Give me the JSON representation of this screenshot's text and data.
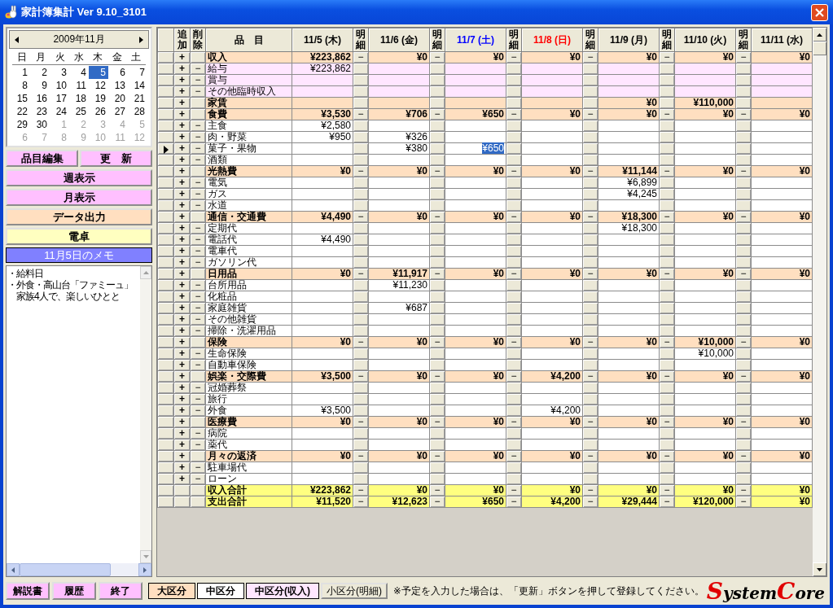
{
  "window": {
    "title": "家計簿集計 Ver 9.10_3101"
  },
  "calendar": {
    "title": "2009年11月",
    "weekdays": [
      "日",
      "月",
      "火",
      "水",
      "木",
      "金",
      "土"
    ],
    "days": [
      {
        "d": "1",
        "other_month": false,
        "selected": false
      },
      {
        "d": "2",
        "other_month": false,
        "selected": false
      },
      {
        "d": "3",
        "other_month": false,
        "selected": false
      },
      {
        "d": "4",
        "other_month": false,
        "selected": false
      },
      {
        "d": "5",
        "other_month": false,
        "selected": true
      },
      {
        "d": "6",
        "other_month": false,
        "selected": false
      },
      {
        "d": "7",
        "other_month": false,
        "selected": false
      },
      {
        "d": "8",
        "other_month": false,
        "selected": false
      },
      {
        "d": "9",
        "other_month": false,
        "selected": false
      },
      {
        "d": "10",
        "other_month": false,
        "selected": false
      },
      {
        "d": "11",
        "other_month": false,
        "selected": false
      },
      {
        "d": "12",
        "other_month": false,
        "selected": false
      },
      {
        "d": "13",
        "other_month": false,
        "selected": false
      },
      {
        "d": "14",
        "other_month": false,
        "selected": false
      },
      {
        "d": "15",
        "other_month": false,
        "selected": false
      },
      {
        "d": "16",
        "other_month": false,
        "selected": false
      },
      {
        "d": "17",
        "other_month": false,
        "selected": false
      },
      {
        "d": "18",
        "other_month": false,
        "selected": false
      },
      {
        "d": "19",
        "other_month": false,
        "selected": false
      },
      {
        "d": "20",
        "other_month": false,
        "selected": false
      },
      {
        "d": "21",
        "other_month": false,
        "selected": false
      },
      {
        "d": "22",
        "other_month": false,
        "selected": false
      },
      {
        "d": "23",
        "other_month": false,
        "selected": false
      },
      {
        "d": "24",
        "other_month": false,
        "selected": false
      },
      {
        "d": "25",
        "other_month": false,
        "selected": false
      },
      {
        "d": "26",
        "other_month": false,
        "selected": false
      },
      {
        "d": "27",
        "other_month": false,
        "selected": false
      },
      {
        "d": "28",
        "other_month": false,
        "selected": false
      },
      {
        "d": "29",
        "other_month": false,
        "selected": false
      },
      {
        "d": "30",
        "other_month": false,
        "selected": false
      },
      {
        "d": "1",
        "other_month": true,
        "selected": false
      },
      {
        "d": "2",
        "other_month": true,
        "selected": false
      },
      {
        "d": "3",
        "other_month": true,
        "selected": false
      },
      {
        "d": "4",
        "other_month": true,
        "selected": false
      },
      {
        "d": "5",
        "other_month": true,
        "selected": false
      },
      {
        "d": "6",
        "other_month": true,
        "selected": false
      },
      {
        "d": "7",
        "other_month": true,
        "selected": false
      },
      {
        "d": "8",
        "other_month": true,
        "selected": false
      },
      {
        "d": "9",
        "other_month": true,
        "selected": false
      },
      {
        "d": "10",
        "other_month": true,
        "selected": false
      },
      {
        "d": "11",
        "other_month": true,
        "selected": false
      },
      {
        "d": "12",
        "other_month": true,
        "selected": false
      }
    ]
  },
  "side_buttons": [
    [
      {
        "label": "品目編集",
        "color": "#ffc0ff"
      },
      {
        "label": "更　新",
        "color": "#ffc0ff"
      }
    ],
    [
      {
        "label": "週表示",
        "color": "#ffc0ff"
      }
    ],
    [
      {
        "label": "月表示",
        "color": "#ffc0ff"
      }
    ],
    [
      {
        "label": "データ出力",
        "color": "#ffdfc0"
      }
    ],
    [
      {
        "label": "電卓",
        "color": "#ffffc0"
      }
    ]
  ],
  "memo": {
    "title": "11月5日のメモ",
    "lines": [
      {
        "text": "・給料日",
        "indent": false
      },
      {
        "text": "・外食・高山台「ファミーュ」",
        "indent": false
      },
      {
        "text": "家族4人で、楽しいひとと",
        "indent": true
      }
    ]
  },
  "table": {
    "headers": {
      "add": "追加",
      "remove": "削除",
      "item": "品　目"
    },
    "columns": [
      {
        "label": "11/5 (木)",
        "color": "#000000",
        "selected": false,
        "detail_header": "明細"
      },
      {
        "label": "11/6 (金)",
        "color": "#000000",
        "selected": false,
        "detail_header": "明細"
      },
      {
        "label": "11/7 (土)",
        "color": "#0000ff",
        "selected": true,
        "detail_header": "明細"
      },
      {
        "label": "11/8 (日)",
        "color": "#ff0000",
        "selected": false,
        "detail_header": "明細"
      },
      {
        "label": "11/9 (月)",
        "color": "#000000",
        "selected": false,
        "detail_header": "明細"
      },
      {
        "label": "11/10 (火)",
        "color": "#000000",
        "selected": false,
        "detail_header": "明細"
      },
      {
        "label": "11/11 (水)",
        "color": "#000000",
        "selected": false
      }
    ],
    "rows": [
      {
        "kind": "category",
        "name": "収入",
        "add": "+",
        "detail": "−",
        "selected": false,
        "cells": [
          "¥223,862",
          "¥0",
          "¥0",
          "¥0",
          "¥0",
          "¥0",
          "¥0"
        ]
      },
      {
        "kind": "income",
        "name": "給与",
        "add": "+",
        "remove": "−",
        "selected": false,
        "cells": [
          "¥223,862",
          null,
          null,
          null,
          null,
          null,
          null
        ]
      },
      {
        "kind": "income",
        "name": "賞与",
        "add": "+",
        "remove": "−",
        "selected": false,
        "cells": [
          null,
          null,
          null,
          null,
          null,
          null,
          null
        ]
      },
      {
        "kind": "income",
        "name": "その他臨時収入",
        "add": "+",
        "remove": "−",
        "selected": false,
        "cells": [
          null,
          null,
          null,
          null,
          null,
          null,
          null
        ]
      },
      {
        "kind": "category",
        "name": "家賃",
        "add": "+",
        "selected": false,
        "cells": [
          null,
          null,
          null,
          null,
          "¥0",
          "¥110,000",
          null
        ]
      },
      {
        "kind": "category",
        "name": "食費",
        "add": "+",
        "detail": "−",
        "selected": false,
        "cells": [
          "¥3,530",
          "¥706",
          "¥650",
          "¥0",
          "¥0",
          "¥0",
          "¥0"
        ]
      },
      {
        "kind": "item",
        "name": "主食",
        "add": "+",
        "remove": "−",
        "selected": false,
        "cells": [
          "¥2,580",
          null,
          null,
          null,
          null,
          null,
          null
        ]
      },
      {
        "kind": "item",
        "name": "肉・野菜",
        "add": "+",
        "remove": "−",
        "selected": false,
        "cells": [
          "¥950",
          "¥326",
          null,
          null,
          null,
          null,
          null
        ]
      },
      {
        "kind": "item",
        "name": "菓子・果物",
        "add": "+",
        "remove": "−",
        "selected": true,
        "cells": [
          null,
          "¥380",
          "¥650",
          null,
          null,
          null,
          null
        ]
      },
      {
        "kind": "item",
        "name": "酒類",
        "add": "+",
        "remove": "−",
        "selected": false,
        "cells": [
          null,
          null,
          null,
          null,
          null,
          null,
          null
        ]
      },
      {
        "kind": "category",
        "name": "光熱費",
        "add": "+",
        "detail": "−",
        "selected": false,
        "cells": [
          "¥0",
          "¥0",
          "¥0",
          "¥0",
          "¥11,144",
          "¥0",
          "¥0"
        ]
      },
      {
        "kind": "item",
        "name": "電気",
        "add": "+",
        "remove": "−",
        "selected": false,
        "cells": [
          null,
          null,
          null,
          null,
          "¥6,899",
          null,
          null
        ]
      },
      {
        "kind": "item",
        "name": "ガス",
        "add": "+",
        "remove": "−",
        "selected": false,
        "cells": [
          null,
          null,
          null,
          null,
          "¥4,245",
          null,
          null
        ]
      },
      {
        "kind": "item",
        "name": "水道",
        "add": "+",
        "remove": "−",
        "selected": false,
        "cells": [
          null,
          null,
          null,
          null,
          null,
          null,
          null
        ]
      },
      {
        "kind": "category",
        "name": "通信・交通費",
        "add": "+",
        "detail": "−",
        "selected": false,
        "cells": [
          "¥4,490",
          "¥0",
          "¥0",
          "¥0",
          "¥18,300",
          "¥0",
          "¥0"
        ]
      },
      {
        "kind": "item",
        "name": "定期代",
        "add": "+",
        "remove": "−",
        "selected": false,
        "cells": [
          null,
          null,
          null,
          null,
          "¥18,300",
          null,
          null
        ]
      },
      {
        "kind": "item",
        "name": "電話代",
        "add": "+",
        "remove": "−",
        "selected": false,
        "cells": [
          "¥4,490",
          null,
          null,
          null,
          null,
          null,
          null
        ]
      },
      {
        "kind": "item",
        "name": "電車代",
        "add": "+",
        "remove": "−",
        "selected": false,
        "cells": [
          null,
          null,
          null,
          null,
          null,
          null,
          null
        ]
      },
      {
        "kind": "item",
        "name": "ガソリン代",
        "add": "+",
        "remove": "−",
        "selected": false,
        "cells": [
          null,
          null,
          null,
          null,
          null,
          null,
          null
        ]
      },
      {
        "kind": "category",
        "name": "日用品",
        "add": "+",
        "detail": "−",
        "selected": false,
        "cells": [
          "¥0",
          "¥11,917",
          "¥0",
          "¥0",
          "¥0",
          "¥0",
          "¥0"
        ]
      },
      {
        "kind": "item",
        "name": "台所用品",
        "add": "+",
        "remove": "−",
        "selected": false,
        "cells": [
          null,
          "¥11,230",
          null,
          null,
          null,
          null,
          null
        ]
      },
      {
        "kind": "item",
        "name": "化粧品",
        "add": "+",
        "remove": "−",
        "selected": false,
        "cells": [
          null,
          null,
          null,
          null,
          null,
          null,
          null
        ]
      },
      {
        "kind": "item",
        "name": "家庭雑貨",
        "add": "+",
        "remove": "−",
        "selected": false,
        "cells": [
          null,
          "¥687",
          null,
          null,
          null,
          null,
          null
        ]
      },
      {
        "kind": "item",
        "name": "その他雑貨",
        "add": "+",
        "remove": "−",
        "selected": false,
        "cells": [
          null,
          null,
          null,
          null,
          null,
          null,
          null
        ]
      },
      {
        "kind": "item",
        "name": "掃除・洗濯用品",
        "add": "+",
        "remove": "−",
        "selected": false,
        "cells": [
          null,
          null,
          null,
          null,
          null,
          null,
          null
        ]
      },
      {
        "kind": "category",
        "name": "保険",
        "add": "+",
        "detail": "−",
        "selected": false,
        "cells": [
          "¥0",
          "¥0",
          "¥0",
          "¥0",
          "¥0",
          "¥10,000",
          "¥0"
        ]
      },
      {
        "kind": "item",
        "name": "生命保険",
        "add": "+",
        "remove": "−",
        "selected": false,
        "cells": [
          null,
          null,
          null,
          null,
          null,
          "¥10,000",
          null
        ]
      },
      {
        "kind": "item",
        "name": "自動車保険",
        "add": "+",
        "remove": "−",
        "selected": false,
        "cells": [
          null,
          null,
          null,
          null,
          null,
          null,
          null
        ]
      },
      {
        "kind": "category",
        "name": "娯楽・交際費",
        "add": "+",
        "detail": "−",
        "selected": false,
        "cells": [
          "¥3,500",
          "¥0",
          "¥0",
          "¥4,200",
          "¥0",
          "¥0",
          "¥0"
        ]
      },
      {
        "kind": "item",
        "name": "冠婚葬祭",
        "add": "+",
        "remove": "−",
        "selected": false,
        "cells": [
          null,
          null,
          null,
          null,
          null,
          null,
          null
        ]
      },
      {
        "kind": "item",
        "name": "旅行",
        "add": "+",
        "remove": "−",
        "selected": false,
        "cells": [
          null,
          null,
          null,
          null,
          null,
          null,
          null
        ]
      },
      {
        "kind": "item",
        "name": "外食",
        "add": "+",
        "remove": "−",
        "selected": false,
        "cells": [
          "¥3,500",
          null,
          null,
          "¥4,200",
          null,
          null,
          null
        ]
      },
      {
        "kind": "category",
        "name": "医療費",
        "add": "+",
        "detail": "−",
        "selected": false,
        "cells": [
          "¥0",
          "¥0",
          "¥0",
          "¥0",
          "¥0",
          "¥0",
          "¥0"
        ]
      },
      {
        "kind": "item",
        "name": "病院",
        "add": "+",
        "remove": "−",
        "selected": false,
        "cells": [
          null,
          null,
          null,
          null,
          null,
          null,
          null
        ]
      },
      {
        "kind": "item",
        "name": "薬代",
        "add": "+",
        "remove": "−",
        "selected": false,
        "cells": [
          null,
          null,
          null,
          null,
          null,
          null,
          null
        ]
      },
      {
        "kind": "category",
        "name": "月々の返済",
        "add": "+",
        "detail": "−",
        "selected": false,
        "cells": [
          "¥0",
          "¥0",
          "¥0",
          "¥0",
          "¥0",
          "¥0",
          "¥0"
        ]
      },
      {
        "kind": "item",
        "name": "駐車場代",
        "add": "+",
        "remove": "−",
        "selected": false,
        "cells": [
          null,
          null,
          null,
          null,
          null,
          null,
          null
        ]
      },
      {
        "kind": "item",
        "name": "ローン",
        "add": "+",
        "remove": "−",
        "selected": false,
        "cells": [
          null,
          null,
          null,
          null,
          null,
          null,
          null
        ]
      },
      {
        "kind": "total",
        "name": "収入合計",
        "detail": "−",
        "selected": false,
        "cells": [
          "¥223,862",
          "¥0",
          "¥0",
          "¥0",
          "¥0",
          "¥0",
          "¥0"
        ]
      },
      {
        "kind": "total",
        "name": "支出合計",
        "detail": "−",
        "selected": false,
        "cells": [
          "¥11,520",
          "¥12,623",
          "¥650",
          "¥4,200",
          "¥29,444",
          "¥120,000",
          "¥0"
        ]
      }
    ]
  },
  "footer_buttons": [
    "解説書",
    "履歴",
    "終了"
  ],
  "legend": [
    {
      "label": "大区分",
      "color": "#ffdfc0"
    },
    {
      "label": "中区分",
      "color": "#ffffff"
    },
    {
      "label": "中区分(収入)",
      "color": "#ffe6ff"
    },
    {
      "label": "小区分(明細)",
      "color": "#ece9d8"
    }
  ],
  "note": "※予定を入力した場合は、「更新」ボタンを押して登録してください。",
  "logo": [
    {
      "text": "S",
      "color": "#e00000"
    },
    {
      "text": "ystem",
      "color": "#000000"
    },
    {
      "text": "C",
      "color": "#e00000"
    },
    {
      "text": "ore",
      "color": "#000000"
    }
  ]
}
